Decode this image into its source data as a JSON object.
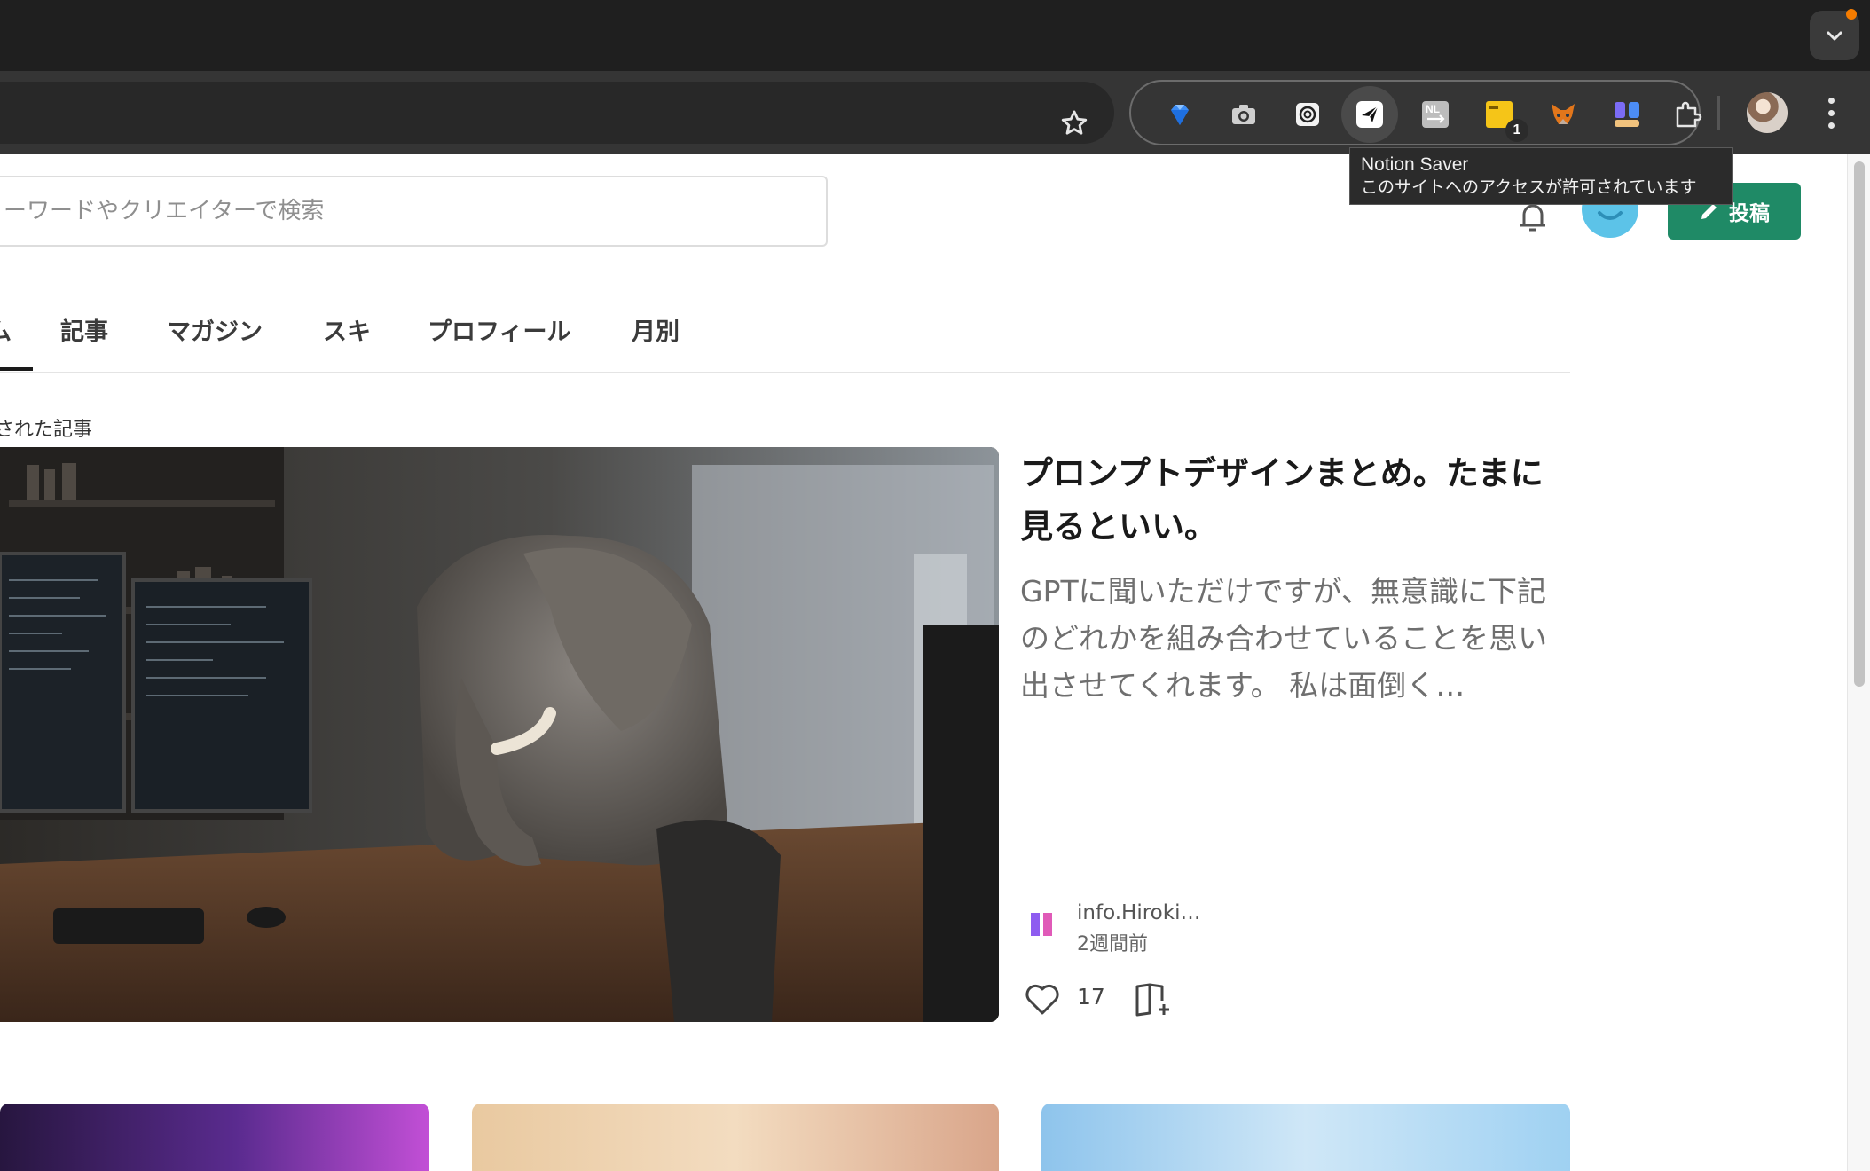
{
  "browser": {
    "tooltip": {
      "title": "Notion Saver",
      "subtitle": "このサイトへのアクセスが許可されています"
    },
    "extension_badge": "1",
    "extensions": [
      "gem-icon",
      "camera-icon",
      "chatgpt-icon",
      "notion-saver-icon",
      "translate-icon",
      "sticky-note-icon",
      "metamask-fox-icon",
      "group-icon",
      "puzzle-icon"
    ]
  },
  "page": {
    "search": {
      "placeholder": "ーワードやクリエイターで検索"
    },
    "post_button": "投稿",
    "tabs": [
      "ム",
      "記事",
      "マガジン",
      "スキ",
      "プロフィール",
      "月別"
    ],
    "section_label": "された記事",
    "article": {
      "title": "プロンプトデザインまとめ。たまに見るといい。",
      "excerpt": "GPTに聞いただけですが、無意識に下記のどれかを組み合わせていることを思い出させてくれます。 私は面倒く…",
      "author": "info.Hiroki…",
      "time": "2週間前",
      "likes": "17"
    }
  },
  "colors": {
    "accent": "#1f8a66",
    "chrome_dark": "#1f1f1f",
    "chrome_toolbar": "#353535"
  }
}
